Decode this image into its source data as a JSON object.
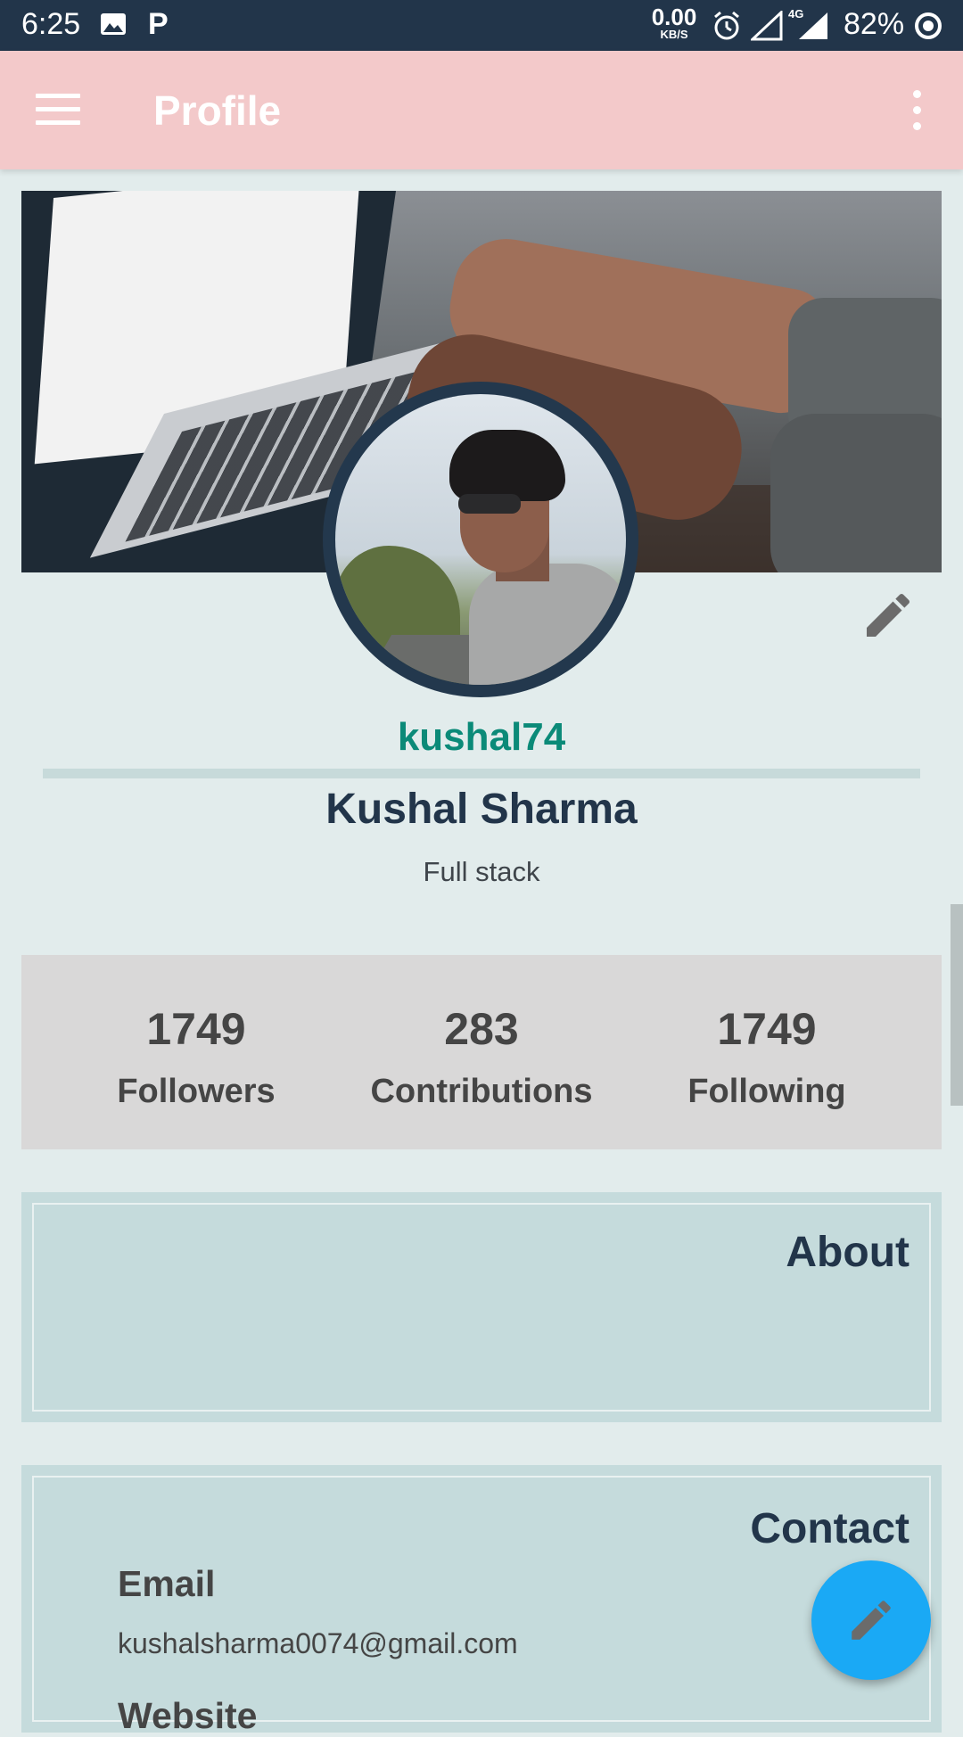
{
  "status_bar": {
    "time": "6:25",
    "p_label": "P",
    "speed_value": "0.00",
    "speed_unit": "KB/S",
    "network": "4G",
    "battery": "82%"
  },
  "app_bar": {
    "title": "Profile",
    "color": "#f3c9ca"
  },
  "profile": {
    "username": "kushal74",
    "full_name": "Kushal Sharma",
    "tagline": "Full stack"
  },
  "stats": [
    {
      "value": "1749",
      "label": "Followers"
    },
    {
      "value": "283",
      "label": "Contributions"
    },
    {
      "value": "1749",
      "label": "Following"
    }
  ],
  "about": {
    "title": "About"
  },
  "contact": {
    "title": "Contact",
    "email_label": "Email",
    "email_value": "kushalsharma0074@gmail.com",
    "website_label": "Website"
  },
  "icons": {
    "menu": "menu-icon",
    "overflow": "more-vert-icon",
    "edit": "pencil-icon",
    "fab": "pencil-icon"
  },
  "colors": {
    "accent": "#1aa9f5",
    "username": "#0b8a78",
    "dark": "#22354a"
  }
}
